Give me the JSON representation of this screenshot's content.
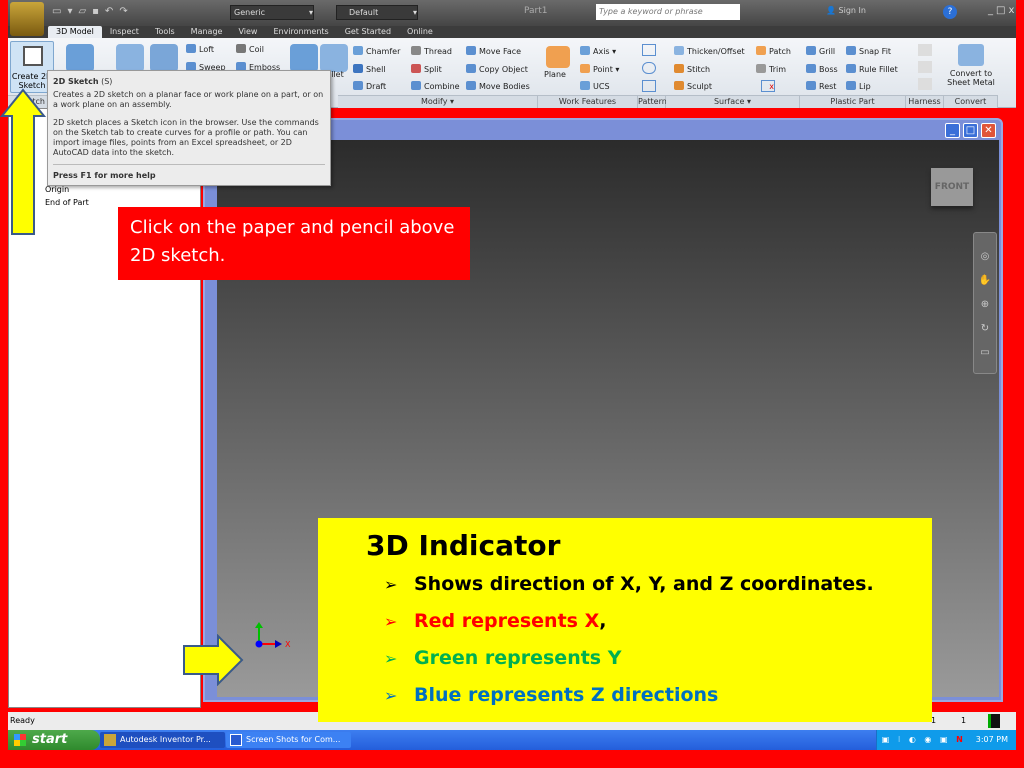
{
  "titlebar": {
    "style_select": "Generic",
    "appearance_select": "Default",
    "document_title": "Part1",
    "search_placeholder": "Type a keyword or phrase",
    "sign_in": "Sign In",
    "window_controls": [
      "_",
      "□",
      "x"
    ]
  },
  "tabs": [
    "3D Model",
    "Inspect",
    "Tools",
    "Manage",
    "View",
    "Environments",
    "Get Started",
    "Online"
  ],
  "ribbon": {
    "create_sketch": "Create 2D Sketch",
    "sketch_panel": "Sketch",
    "create_tools": [
      "Loft",
      "Coil",
      "Sweep",
      "Emboss"
    ],
    "fillet_partial": "illet",
    "modify": [
      "Chamfer",
      "Thread",
      "Move Face",
      "Shell",
      "Split",
      "Copy Object",
      "Draft",
      "Combine",
      "Move Bodies"
    ],
    "modify_label": "Modify",
    "work_features": [
      "Plane",
      "Axis",
      "Point",
      "UCS"
    ],
    "work_features_label": "Work Features",
    "pattern_label": "Pattern",
    "surface": [
      "Thicken/Offset",
      "Patch",
      "Stitch",
      "Trim",
      "Sculpt"
    ],
    "surface_label": "Surface",
    "plastic": [
      "Grill",
      "Snap Fit",
      "Boss",
      "Rule Fillet",
      "Rest",
      "Lip"
    ],
    "plastic_label": "Plastic Part",
    "harness_label": "Harness",
    "convert_button": "Convert to Sheet Metal",
    "convert_label": "Convert"
  },
  "tooltip": {
    "title": "2D Sketch",
    "shortcut": "(S)",
    "line1": "Creates a 2D sketch on a planar face or work plane on a part, or on a work plane on an assembly.",
    "line2": "2D sketch places a Sketch icon in the browser. Use the commands on the Sketch tab to create curves for a profile or path. You can import image files, points from an Excel spreadsheet, or 2D AutoCAD data into the sketch.",
    "help": "Press F1 for more help"
  },
  "browser": {
    "items": [
      "Origin",
      "End of Part"
    ]
  },
  "viewcube": {
    "face": "FRONT"
  },
  "axis": {
    "x_label": "X",
    "colors": {
      "x": "#ff0000",
      "y": "#00c000",
      "z": "#0000ff"
    }
  },
  "status": {
    "text": "Ready",
    "counts": [
      "1",
      "1"
    ]
  },
  "taskbar": {
    "start": "start",
    "tasks": [
      "Autodesk Inventor Pr...",
      "Screen Shots for Com..."
    ],
    "time": "3:07 PM"
  },
  "callout": {
    "text": "Click on the paper and pencil above 2D sketch."
  },
  "info": {
    "title": "3D Indicator",
    "bullets": [
      {
        "text": "Shows direction of X, Y, and Z coordinates.",
        "color": "#000000"
      },
      {
        "text": "Red represents X",
        "suffix": ",",
        "color": "#ff0000"
      },
      {
        "text": "Green represents Y",
        "color": "#00b050"
      },
      {
        "text": "Blue represents Z directions",
        "color": "#0070c0"
      }
    ]
  }
}
